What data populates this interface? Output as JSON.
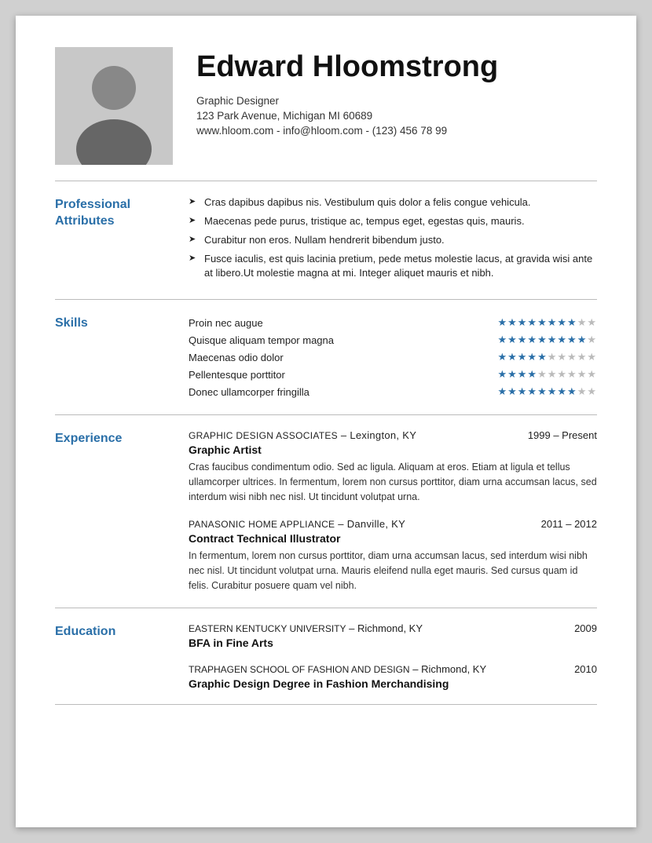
{
  "header": {
    "name": "Edward Hloomstrong",
    "title": "Graphic Designer",
    "address": "123 Park Avenue, Michigan MI 60689",
    "contact": "www.hloom.com - info@hloom.com - (123) 456 78 99"
  },
  "sections": {
    "professional": {
      "label": "Professional\nAttributes",
      "items": [
        "Cras dapibus dapibus nis. Vestibulum quis dolor a felis congue vehicula.",
        "Maecenas pede purus, tristique ac, tempus eget, egestas quis, mauris.",
        "Curabitur non eros. Nullam hendrerit bibendum justo.",
        "Fusce iaculis, est quis lacinia pretium, pede metus molestie lacus, at gravida wisi ante at libero.Ut molestie magna at mi. Integer aliquet mauris et nibh."
      ]
    },
    "skills": {
      "label": "Skills",
      "items": [
        {
          "name": "Proin nec augue",
          "filled": 8,
          "total": 10
        },
        {
          "name": "Quisque aliquam tempor magna",
          "filled": 9,
          "total": 10
        },
        {
          "name": "Maecenas odio dolor",
          "filled": 5,
          "total": 10
        },
        {
          "name": "Pellentesque porttitor",
          "filled": 4,
          "total": 10
        },
        {
          "name": "Donec ullamcorper fringilla",
          "filled": 8,
          "total": 10
        }
      ]
    },
    "experience": {
      "label": "Experience",
      "items": [
        {
          "company": "Graphic Design Associates",
          "company_suffix": "– Lexington, KY",
          "dates": "1999 – Present",
          "role": "Graphic Artist",
          "description": "Cras faucibus condimentum odio. Sed ac ligula. Aliquam at eros. Etiam at ligula et tellus ullamcorper ultrices. In fermentum, lorem non cursus porttitor, diam urna accumsan lacus, sed interdum wisi nibh nec nisl. Ut tincidunt volutpat urna."
        },
        {
          "company": "Panasonic Home Appliance",
          "company_suffix": "– Danville, KY",
          "dates": "2011 – 2012",
          "role": "Contract Technical Illustrator",
          "description": "In fermentum, lorem non cursus porttitor, diam urna accumsan lacus, sed interdum wisi nibh nec nisl. Ut tincidunt volutpat urna. Mauris eleifend nulla eget mauris. Sed cursus quam id felis. Curabitur posuere quam vel nibh."
        }
      ]
    },
    "education": {
      "label": "Education",
      "items": [
        {
          "school": "Eastern Kentucky University",
          "school_suffix": "– Richmond, KY",
          "year": "2009",
          "degree": "BFA in Fine Arts"
        },
        {
          "school": "Traphagen School of Fashion and Design",
          "school_suffix": "– Richmond, KY",
          "year": "2010",
          "degree": "Graphic Design Degree in Fashion Merchandising"
        }
      ]
    }
  },
  "colors": {
    "accent": "#2a6fa8",
    "star_filled": "#2a6fa8",
    "star_empty": "#bbb"
  }
}
